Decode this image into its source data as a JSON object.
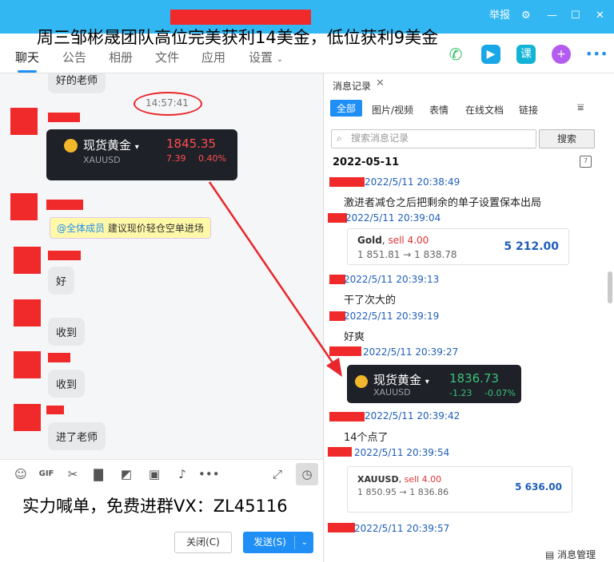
{
  "headline": "周三邹彬晟团队高位完美获利14美金，低位获利9美金",
  "titlebar": {
    "report": "举报",
    "settings_icon": "gear-icon",
    "minimize_icon": "minimize-icon",
    "maximize_icon": "maximize-icon",
    "close_icon": "close-icon"
  },
  "tabs": [
    "聊天",
    "公告",
    "相册",
    "文件",
    "应用",
    "设置"
  ],
  "tab_icons": {
    "phone": "phone-icon",
    "video": "video-icon",
    "class": "课",
    "add": "plus-icon",
    "more": "more-icon"
  },
  "chat": {
    "top_bubble": "好的老师",
    "timestamp": "14:57:41",
    "quote": {
      "name": "现货黄金",
      "code": "XAUUSD",
      "price": "1845.35",
      "change": "7.39",
      "change_pct": "0.40%"
    },
    "mention": {
      "at": "@全体成员",
      "text": "建议现价轻仓空单进场"
    },
    "messages": [
      "好",
      "收到",
      "收到",
      "进了老师"
    ]
  },
  "composer": {
    "promo": "实力喊单，免费进群VX：ZL45116",
    "close_label": "关闭(C)",
    "send_label": "发送(S)"
  },
  "history": {
    "title": "消息记录",
    "tabs": [
      "全部",
      "图片/视频",
      "表情",
      "在线文档",
      "链接"
    ],
    "search_placeholder": "搜索消息记录",
    "search_button": "搜索",
    "date": "2022-05-11",
    "entries": [
      {
        "time": "2022/5/11 20:38:49",
        "text": "激进者减仓之后把剩余的单子设置保本出局"
      },
      {
        "time": "2022/5/11 20:39:04"
      },
      {
        "time": "2022/5/11 20:39:13",
        "text": "干了次大的"
      },
      {
        "time": "2022/5/11 20:39:19",
        "text": "好爽"
      },
      {
        "time": "2022/5/11 20:39:27"
      },
      {
        "time": "2022/5/11 20:39:42",
        "text": "14个点了"
      },
      {
        "time": "2022/5/11 20:39:54"
      },
      {
        "time": "2022/5/11 20:39:57"
      }
    ],
    "trade1": {
      "symbol": "Gold",
      "side": "sell 4.00",
      "from_to": "1 851.81 → 1 838.78",
      "amount": "5 212.00"
    },
    "quote2": {
      "name": "现货黄金",
      "code": "XAUUSD",
      "price": "1836.73",
      "change": "-1.23",
      "change_pct": "-0.07%"
    },
    "trade2": {
      "symbol": "XAUUSD",
      "side": "sell 4.00",
      "from_to": "1 850.95 → 1 836.86",
      "amount": "5 636.00"
    },
    "manage": "消息管理"
  },
  "colors": {
    "titlebar": "#33b7f3",
    "accent": "#1f8ff5",
    "redaction": "#f02a2a",
    "loss_red": "#ff4d4f",
    "gain_green": "#3ac277"
  }
}
